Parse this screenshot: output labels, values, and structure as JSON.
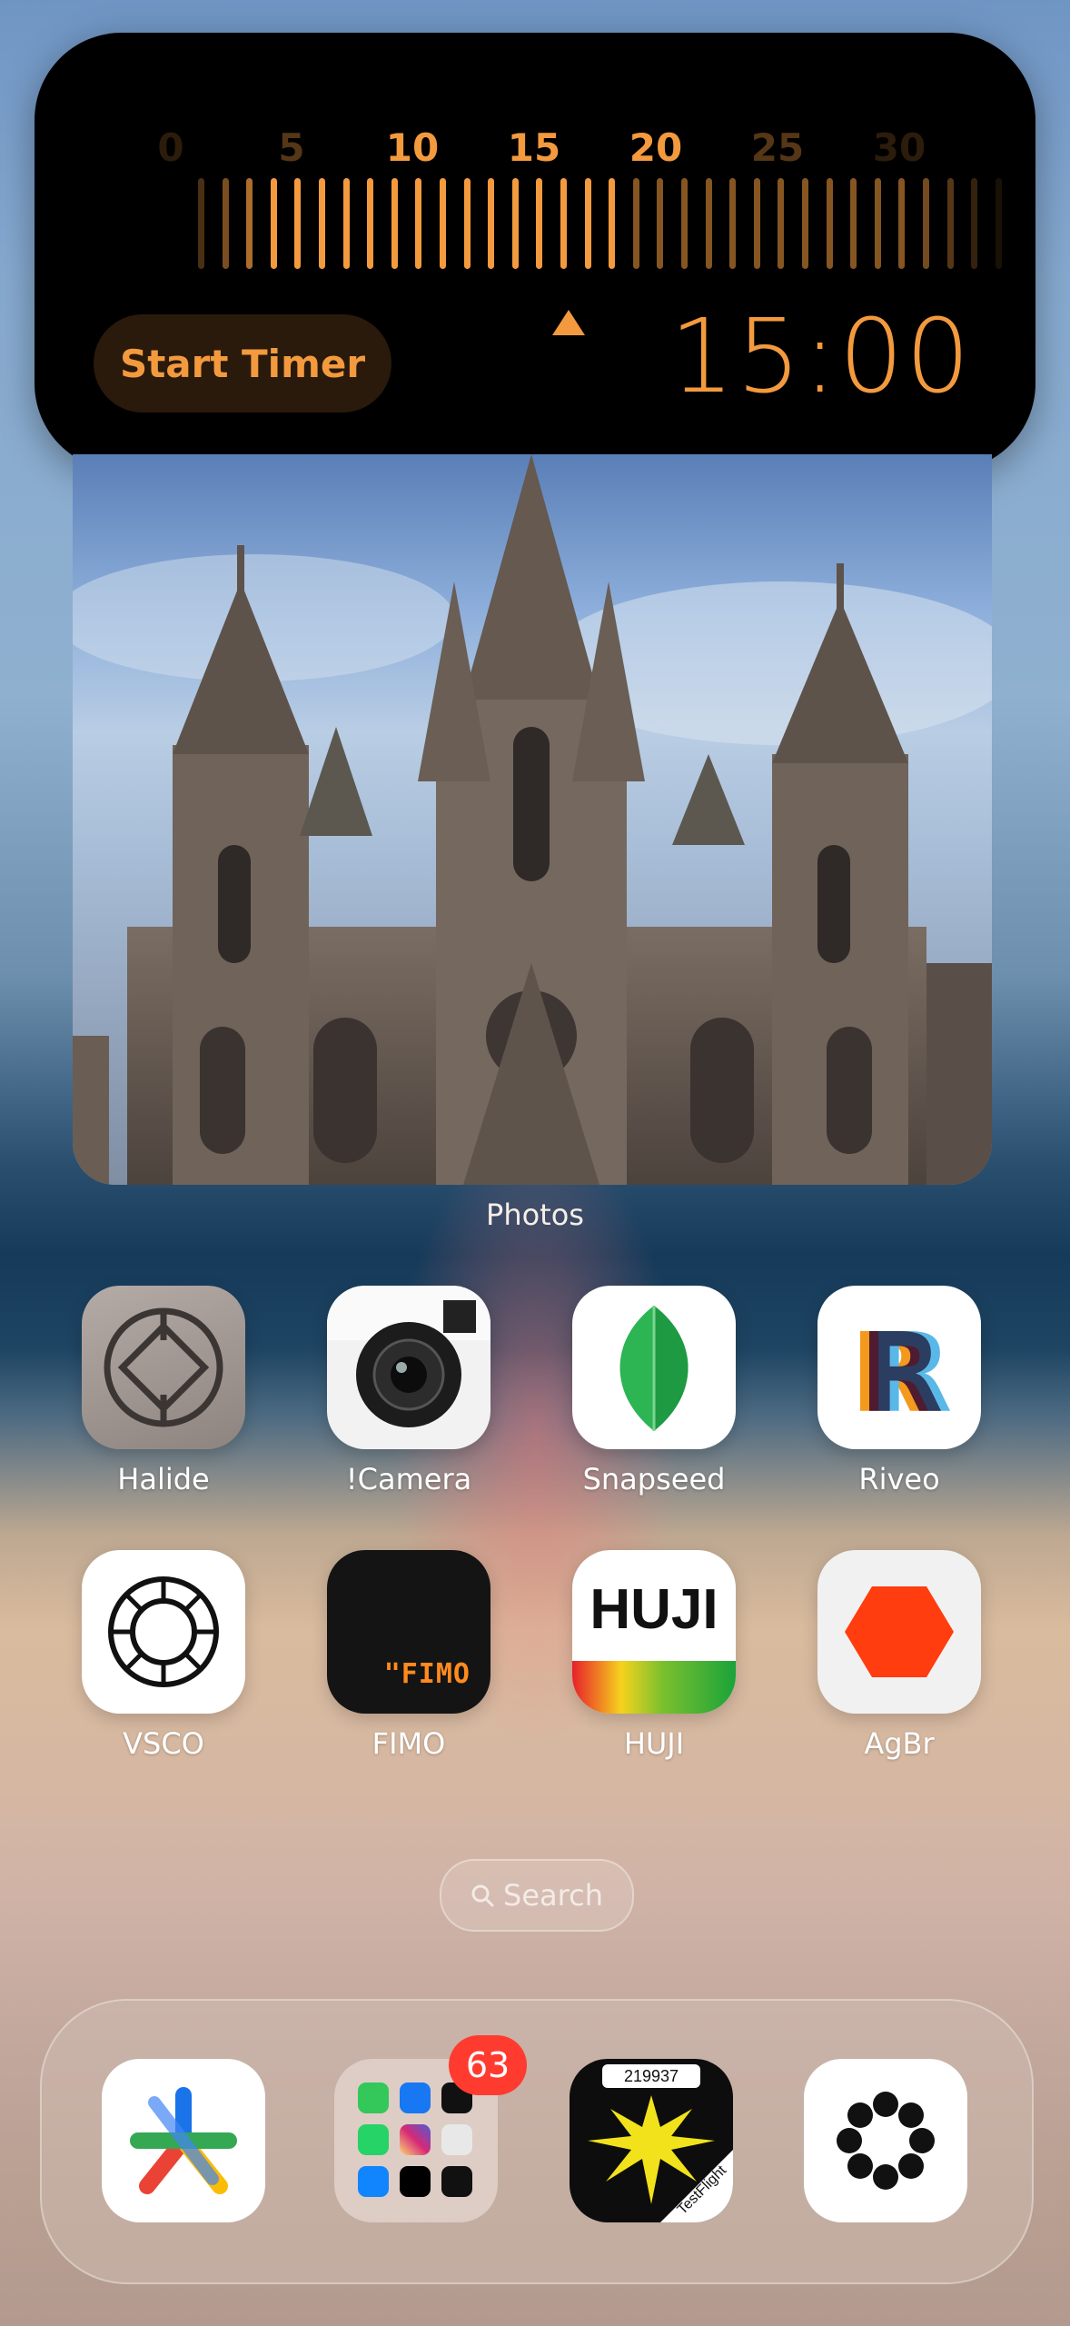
{
  "timer_widget": {
    "scale_labels": [
      "0",
      "5",
      "10",
      "15",
      "20",
      "25",
      "30"
    ],
    "start_label": "Start Timer",
    "time": "15:00",
    "selected_minutes": 15,
    "accent_color": "#f39a3e"
  },
  "photos_widget": {
    "label": "Photos"
  },
  "apps": [
    {
      "name": "Halide"
    },
    {
      "name": "!Camera"
    },
    {
      "name": "Snapseed"
    },
    {
      "name": "Riveo"
    },
    {
      "name": "VSCO"
    },
    {
      "name": "FIMO"
    },
    {
      "name": "HUJI"
    },
    {
      "name": "AgBr"
    }
  ],
  "fimo_logo": "\"FIMO",
  "huji_logo": "HUJI",
  "search": {
    "label": "Search"
  },
  "dock": {
    "folder_badge": "63",
    "testflight_number": "219937",
    "testflight_text": "TestFlight"
  }
}
